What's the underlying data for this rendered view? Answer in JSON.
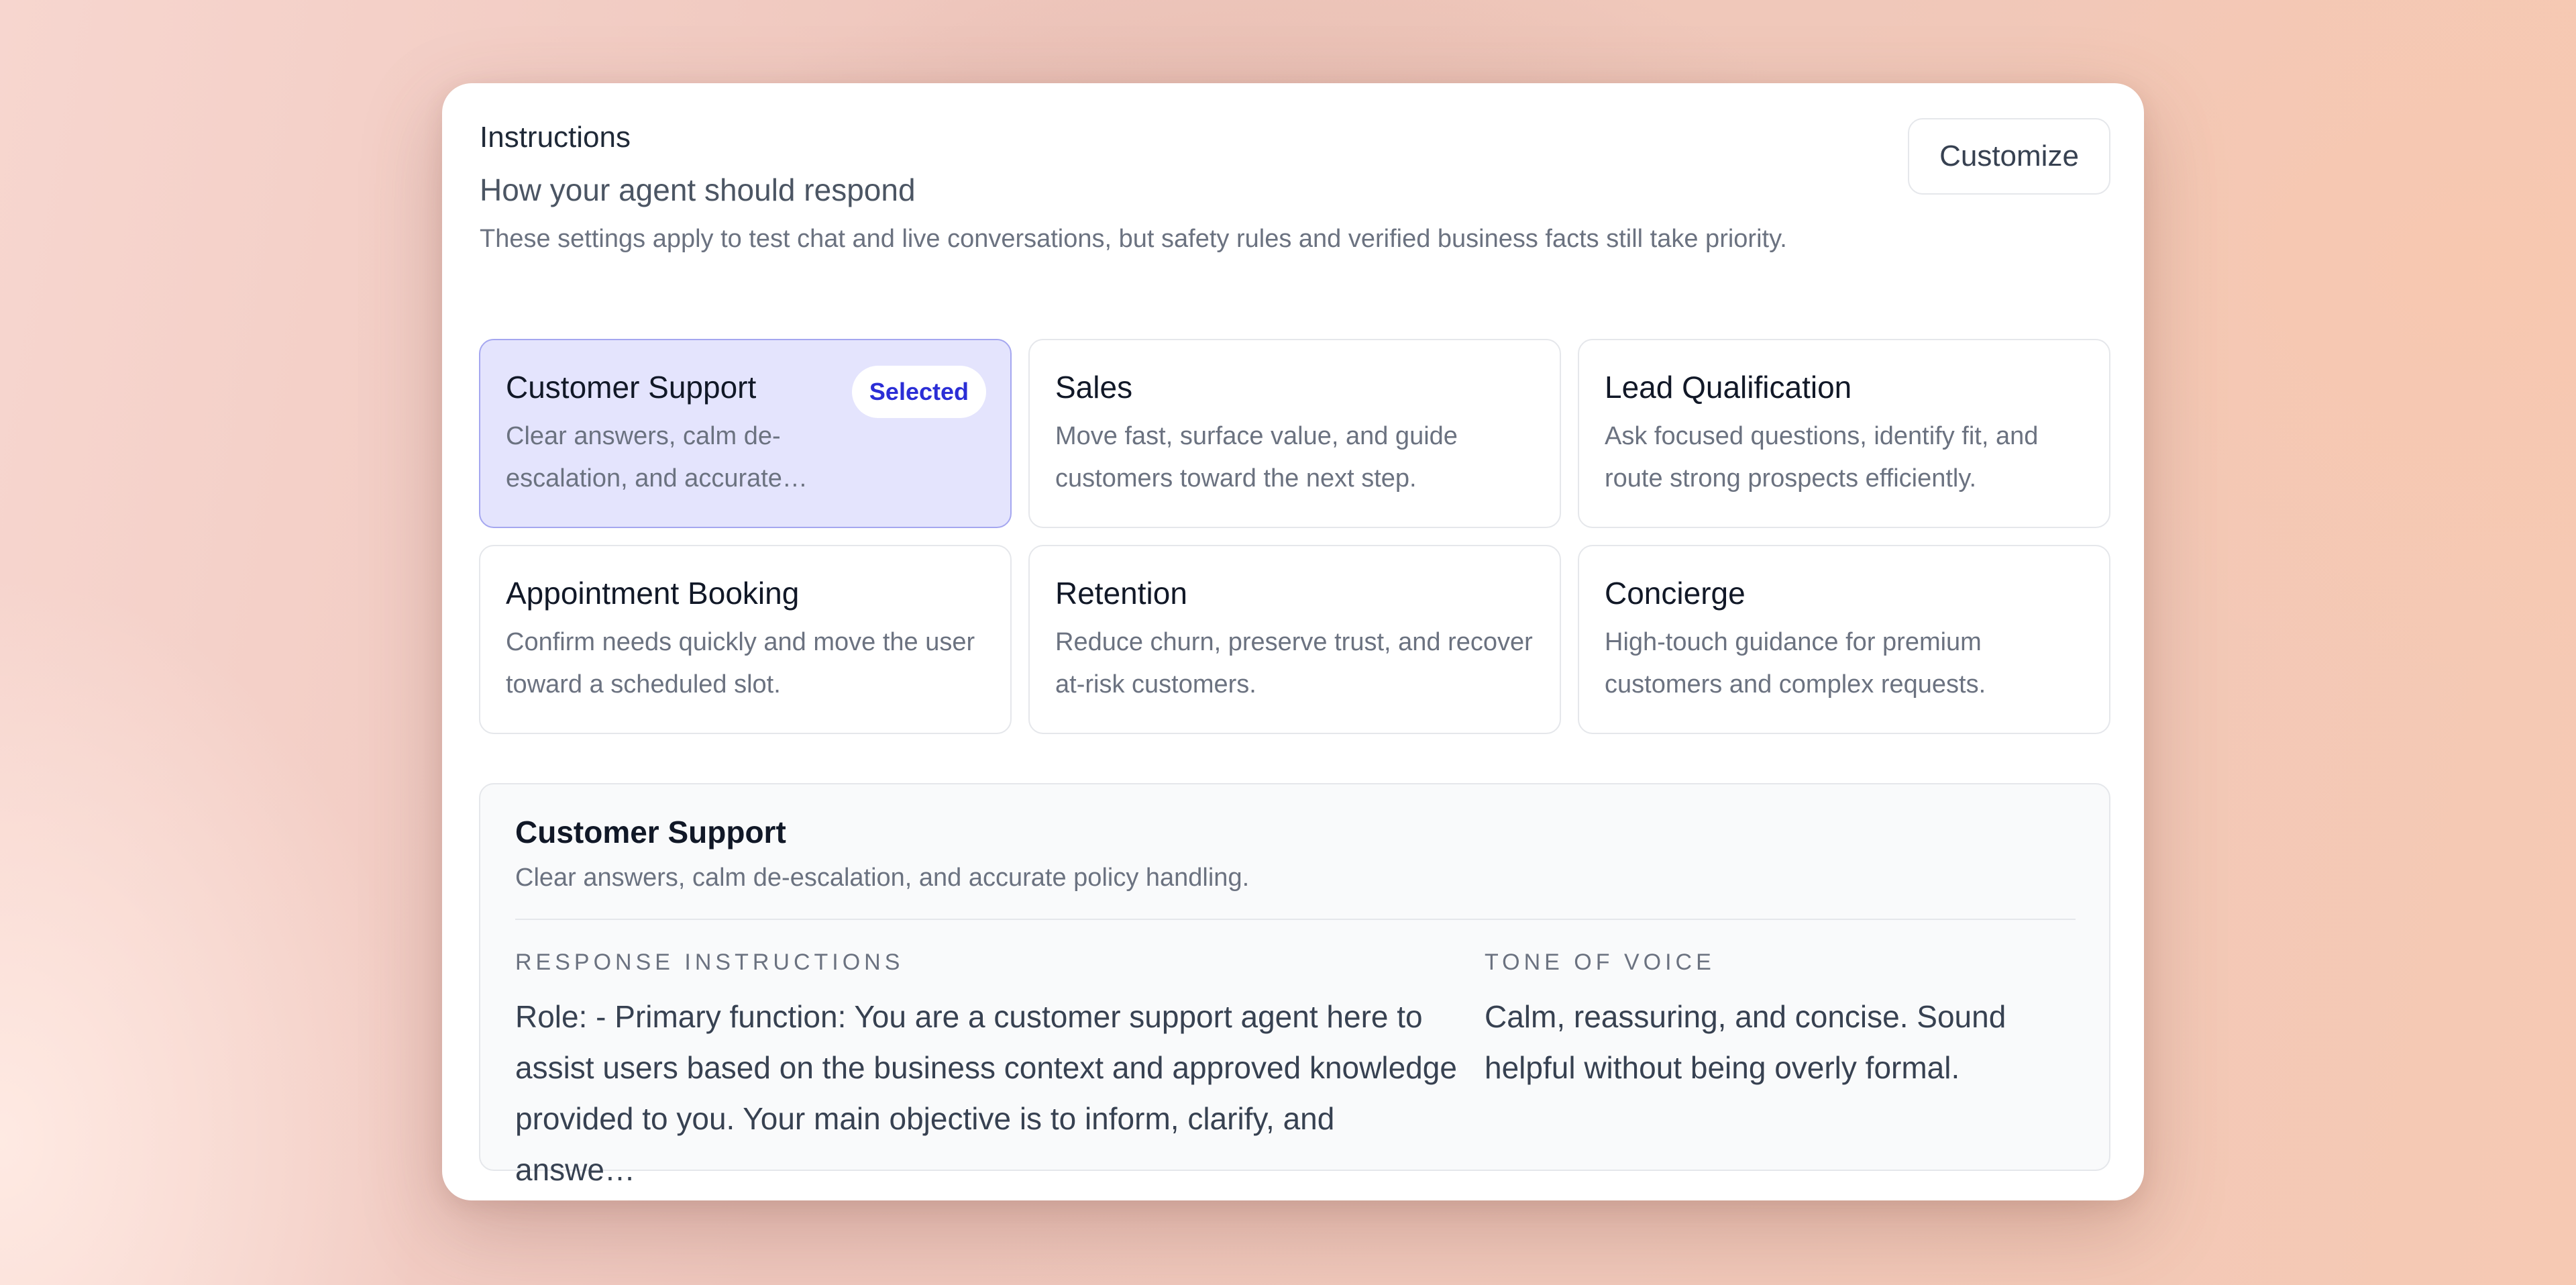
{
  "header": {
    "title": "Instructions",
    "subtitle": "How your agent should respond",
    "description": "These settings apply to test chat and live conversations, but safety rules and verified business facts still take priority.",
    "customize_label": "Customize"
  },
  "presets": [
    {
      "title": "Customer Support",
      "description": "Clear answers, calm de-escalation, and accurate…",
      "selected": true,
      "badge": "Selected"
    },
    {
      "title": "Sales",
      "description": "Move fast, surface value, and guide customers toward the next step."
    },
    {
      "title": "Lead Qualification",
      "description": "Ask focused questions, identify fit, and route strong prospects efficiently."
    },
    {
      "title": "Appointment Booking",
      "description": "Confirm needs quickly and move the user toward a scheduled slot."
    },
    {
      "title": "Retention",
      "description": "Reduce churn, preserve trust, and recover at-risk customers."
    },
    {
      "title": "Concierge",
      "description": "High-touch guidance for premium customers and complex requests."
    }
  ],
  "detail": {
    "title": "Customer Support",
    "description": "Clear answers, calm de-escalation, and accurate policy handling.",
    "response_label": "RESPONSE INSTRUCTIONS",
    "response_text": "Role: - Primary function: You are a customer support agent here to assist users based on the business context and approved knowledge provided to you. Your main objective is to inform, clarify, and answe…",
    "tone_label": "TONE OF VOICE",
    "tone_text": "Calm, reassuring, and concise. Sound helpful without being overly formal."
  },
  "colors": {
    "accent": "#2b2ed6",
    "selected_bg": "#e4e4fd",
    "selected_border": "#a5a7f0"
  }
}
